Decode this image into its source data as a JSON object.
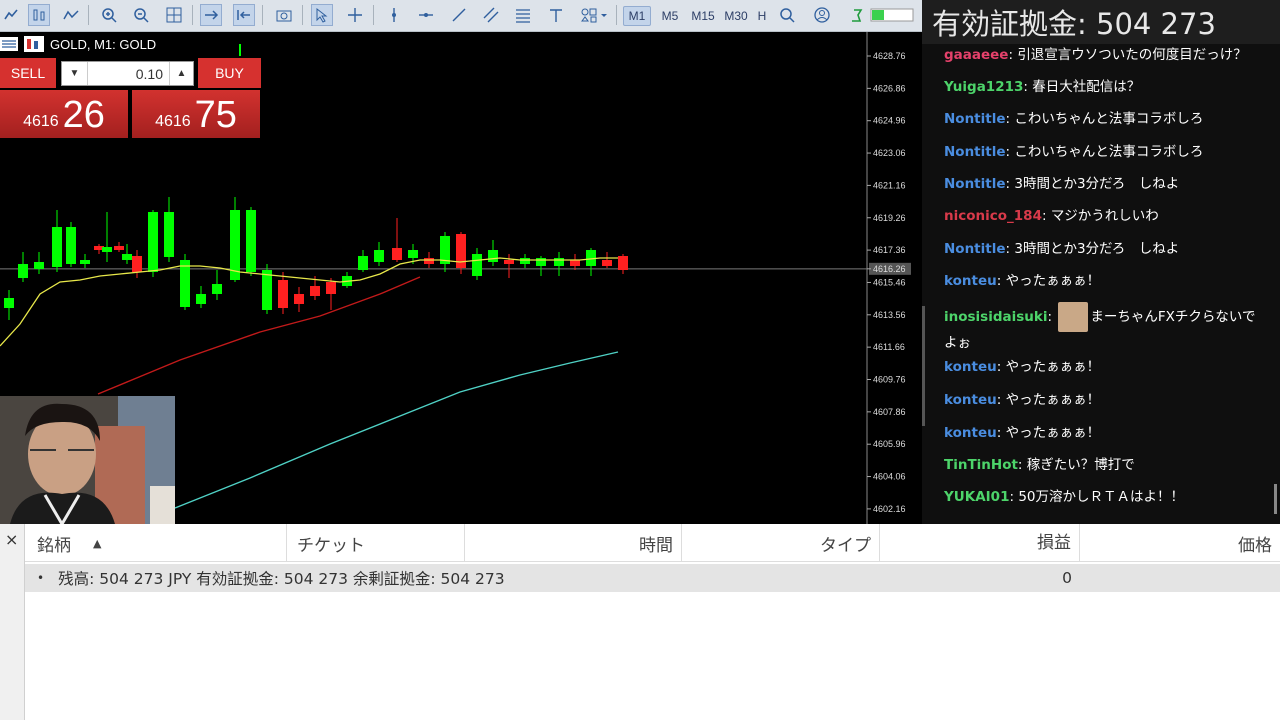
{
  "toolbar": {
    "icons": [
      "indicator-icon",
      "bar-chart-icon",
      "line-chart-icon",
      "zoom-in-icon",
      "zoom-out-icon",
      "grid-icon",
      "autoscroll-icon",
      "chart-shift-icon",
      "screenshot-icon",
      "cursor-icon",
      "crosshair-icon",
      "vertical-line-icon",
      "horizontal-line-icon",
      "trendline-icon",
      "channel-icon",
      "fibonacci-icon",
      "text-icon",
      "shapes-icon"
    ],
    "timeframes": [
      "M1",
      "M5",
      "M15",
      "M30",
      "H"
    ],
    "active_timeframe": "M1"
  },
  "chart": {
    "title": "GOLD, M1:  GOLD",
    "price_labels": [
      "4628.76",
      "4626.86",
      "4624.96",
      "4623.06",
      "4621.16",
      "4619.26",
      "4617.36",
      "4616.26",
      "4615.46",
      "4613.56",
      "4611.66",
      "4609.76",
      "4607.86",
      "4605.96",
      "4604.06",
      "4602.16"
    ],
    "current_price": "4616.26",
    "colors": {
      "bull": "#00ff00",
      "bear": "#ff2020",
      "ma_fast": "#e8e84a",
      "ma_mid": "#c21a1a",
      "ma_slow": "#4fd1c5",
      "bidline": "#7a7a7a"
    }
  },
  "trade_panel": {
    "sell_label": "SELL",
    "buy_label": "BUY",
    "lot": "0.10",
    "sell_prefix": "4616",
    "sell_big": "26",
    "buy_prefix": "4616",
    "buy_big": "75"
  },
  "chat": {
    "header": "有効証拠金: 504 273",
    "messages": [
      {
        "user": "gaaaeee",
        "color": "#e5416b",
        "text": "引退宣言ウソついたの何度目だっけ？"
      },
      {
        "user": "Yuiga1213",
        "color": "#4dd46a",
        "text": "春日大社配信は？"
      },
      {
        "user": "Nontitle",
        "color": "#4a8de0",
        "text": "こわいちゃんと法事コラボしろ"
      },
      {
        "user": "Nontitle",
        "color": "#4a8de0",
        "text": "こわいちゃんと法事コラボしろ"
      },
      {
        "user": "Nontitle",
        "color": "#4a8de0",
        "text": "3時間とか3分だろ　しねよ"
      },
      {
        "user": "niconico_184",
        "color": "#d93a4a",
        "text": "マジかうれしいわ"
      },
      {
        "user": "Nontitle",
        "color": "#4a8de0",
        "text": "3時間とか3分だろ　しねよ"
      },
      {
        "user": "konteu",
        "color": "#4a8de0",
        "text": "やったぁぁぁ！"
      },
      {
        "user": "inosisidaisuki",
        "color": "#4dd46a",
        "text": "まーちゃんFXチクらないでよぉ"
      },
      {
        "user": "konteu",
        "color": "#4a8de0",
        "text": "やったぁぁぁ！"
      },
      {
        "user": "konteu",
        "color": "#4a8de0",
        "text": "やったぁぁぁ！"
      },
      {
        "user": "konteu",
        "color": "#4a8de0",
        "text": "やったぁぁぁ！"
      },
      {
        "user": "TinTinHot",
        "color": "#4dd46a",
        "text": "稼ぎたい？博打で"
      },
      {
        "user": "YUKAI01",
        "color": "#4dd46a",
        "text": "50万溶かしＲＴＡはよ！！"
      }
    ]
  },
  "terminal": {
    "close": "×",
    "columns": [
      "銘柄",
      "チケット",
      "時間",
      "タイプ",
      "損益",
      "価格"
    ],
    "sort_indicator": "▲",
    "balance_text": "残高: 504 273 JPY  有効証拠金: 504 273  余剰証拠金: 504 273",
    "bullet": "•",
    "profit": "0"
  }
}
